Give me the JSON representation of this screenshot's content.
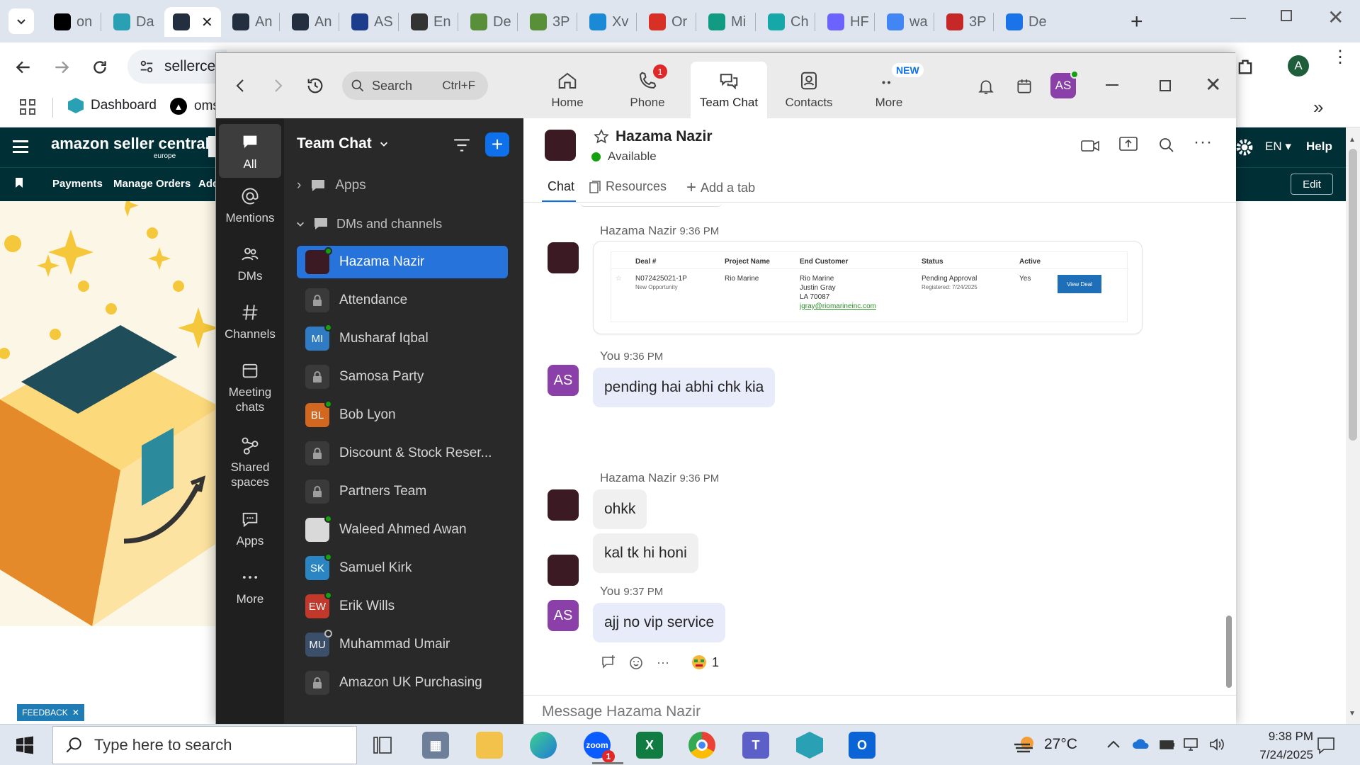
{
  "browser": {
    "tabs": [
      {
        "title": "on",
        "icon": "amazon-a-icon",
        "color": "#000000"
      },
      {
        "title": "Da",
        "icon": "hex-icon",
        "color": "#2aa0b5"
      },
      {
        "title": "",
        "icon": "amazon-icon",
        "color": "#232f3e",
        "active": true
      },
      {
        "title": "An",
        "icon": "amazon-icon",
        "color": "#232f3e"
      },
      {
        "title": "An",
        "icon": "amazon-icon",
        "color": "#232f3e"
      },
      {
        "title": "AS",
        "icon": "play-icon",
        "color": "#1c3c8c"
      },
      {
        "title": "En",
        "icon": "openai-icon",
        "color": "#333333"
      },
      {
        "title": "De",
        "icon": "sheet-icon",
        "color": "#5a8f3a"
      },
      {
        "title": "3P",
        "icon": "sheet-icon",
        "color": "#5a8f3a"
      },
      {
        "title": "Xv",
        "icon": "kanban-icon",
        "color": "#1b8ad6"
      },
      {
        "title": "Or",
        "icon": "mail-icon",
        "color": "#d93025"
      },
      {
        "title": "Mi",
        "icon": "chat-icon",
        "color": "#109b82"
      },
      {
        "title": "Ch",
        "icon": "chat-icon",
        "color": "#16a8a8"
      },
      {
        "title": "HF",
        "icon": "stats-icon",
        "color": "#6c63ff"
      },
      {
        "title": "wa",
        "icon": "google-icon",
        "color": "#4285f4"
      },
      {
        "title": "3P",
        "icon": "shwe-icon",
        "color": "#c62828"
      },
      {
        "title": "De",
        "icon": "form-icon",
        "color": "#1a73e8"
      }
    ],
    "address": "sellerce",
    "profile_initial": "A",
    "bookmarks": [
      {
        "label": "Dashboard",
        "icon": "hex-icon"
      },
      {
        "label": "oms",
        "icon": "amazon-a-icon"
      }
    ]
  },
  "amazon": {
    "logo_text": "amazon seller central",
    "logo_region": "europe",
    "nav": [
      "Payments",
      "Manage Orders",
      "Add"
    ],
    "lang": "EN",
    "help": "Help",
    "edit": "Edit",
    "feedback": "FEEDBACK"
  },
  "teams": {
    "search": {
      "label": "Search",
      "shortcut": "Ctrl+F"
    },
    "nav": [
      {
        "label": "Home",
        "icon": "home-icon"
      },
      {
        "label": "Phone",
        "icon": "phone-icon",
        "badge": "1"
      },
      {
        "label": "Team Chat",
        "icon": "chat-icon",
        "active": true
      },
      {
        "label": "Contacts",
        "icon": "contacts-icon"
      },
      {
        "label": "More",
        "icon": "more-icon",
        "badge": "NEW"
      }
    ],
    "user_initials": "AS",
    "rail": [
      {
        "label": "All",
        "icon": "chat-bubble-icon",
        "active": true
      },
      {
        "label": "Mentions",
        "icon": "at-icon"
      },
      {
        "label": "DMs",
        "icon": "people-icon"
      },
      {
        "label": "Channels",
        "icon": "hash-icon"
      },
      {
        "label": "Meeting chats",
        "icon": "calendar-icon"
      },
      {
        "label": "Shared spaces",
        "icon": "share-icon"
      },
      {
        "label": "Apps",
        "icon": "apps-icon"
      },
      {
        "label": "More",
        "icon": "ellipsis-icon"
      }
    ],
    "list": {
      "title": "Team Chat",
      "sections": {
        "apps": "Apps",
        "dms": "DMs and channels"
      },
      "items": [
        {
          "name": "Hazama Nazir",
          "type": "person",
          "initials": "",
          "color": "#3c1a24",
          "presence": "online",
          "active": true
        },
        {
          "name": "Attendance",
          "type": "locked"
        },
        {
          "name": "Musharaf Iqbal",
          "type": "person",
          "initials": "MI",
          "color": "#2f7bc4",
          "presence": "online"
        },
        {
          "name": "Samosa Party",
          "type": "locked"
        },
        {
          "name": "Bob Lyon",
          "type": "person",
          "initials": "BL",
          "color": "#d2671f",
          "presence": "online"
        },
        {
          "name": "Discount & Stock Reser...",
          "type": "locked"
        },
        {
          "name": "Partners Team",
          "type": "locked"
        },
        {
          "name": "Waleed Ahmed Awan",
          "type": "person",
          "initials": "",
          "color": "#d9d9d9",
          "presence": "online"
        },
        {
          "name": "Samuel Kirk",
          "type": "person",
          "initials": "SK",
          "color": "#2a85c2",
          "presence": "online"
        },
        {
          "name": "Erik Wills",
          "type": "person",
          "initials": "EW",
          "color": "#c2382b",
          "presence": "online"
        },
        {
          "name": "Muhammad Umair",
          "type": "person",
          "initials": "MU",
          "color": "#3b4f6b",
          "presence": "offline"
        },
        {
          "name": "Amazon UK Purchasing",
          "type": "locked"
        }
      ]
    },
    "chat": {
      "contact": "Hazama Nazir",
      "status": "Available",
      "tabs": {
        "chat": "Chat",
        "resources": "Resources",
        "add": "Add a tab"
      },
      "embed": {
        "headers": [
          "Deal #",
          "Project Name",
          "End Customer",
          "Status",
          "Active"
        ],
        "deal": "N072425021-1P",
        "deal_sub": "New Opportunity",
        "project": "Rio Marine",
        "customer": [
          "Rio Marine",
          "Justin Gray",
          "LA 70087"
        ],
        "email": "jgray@riomarineinc.com",
        "status": "Pending Approval",
        "registered": "Registered: 7/24/2025",
        "active": "Yes",
        "button": "View Deal"
      },
      "messages": [
        {
          "sender": "Hazama Nazir",
          "time": "9:36 PM"
        },
        {
          "sender": "You",
          "time": "9:36 PM",
          "text": "pending hai abhi chk kia"
        },
        {
          "sender": "Hazama Nazir",
          "time": "9:36 PM",
          "text": "ohkk",
          "text2": "kal tk hi honi"
        },
        {
          "sender": "You",
          "time": "9:37 PM",
          "text": "ajj no vip service",
          "reaction_count": "1"
        }
      ],
      "composer_placeholder": "Message Hazama Nazir"
    }
  },
  "taskbar": {
    "search_placeholder": "Type here to search",
    "temperature": "27°C",
    "time": "9:38 PM",
    "date": "7/24/2025",
    "zoom_badge": "1"
  }
}
